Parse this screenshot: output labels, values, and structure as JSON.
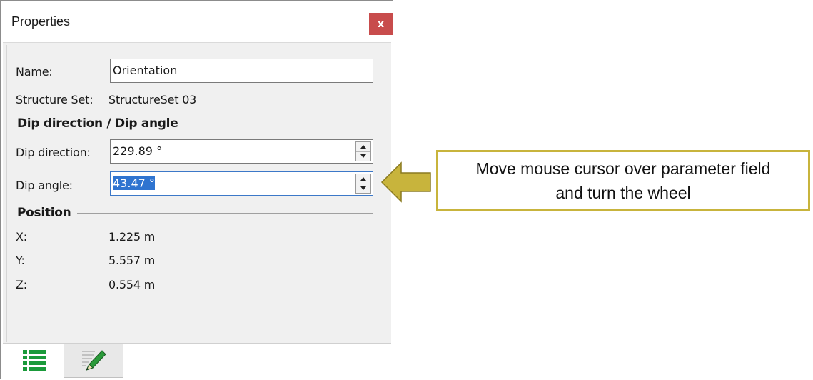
{
  "window": {
    "title": "Properties",
    "close_label": "x"
  },
  "fields": {
    "name_label": "Name:",
    "name_value": "Orientation",
    "structure_set_label": "Structure Set:",
    "structure_set_value": "StructureSet 03"
  },
  "dip_section": {
    "header": "Dip direction / Dip angle",
    "dip_direction_label": "Dip direction:",
    "dip_direction_value": "229.89 °",
    "dip_angle_label": "Dip angle:",
    "dip_angle_value": "43.47 °"
  },
  "position": {
    "header": "Position",
    "x_label": "X:",
    "x_value": "1.225 m",
    "y_label": "Y:",
    "y_value": "5.557 m",
    "z_label": "Z:",
    "z_value": "0.554 m"
  },
  "tabs": [
    {
      "icon": "list-icon",
      "active": true
    },
    {
      "icon": "edit-pencil-icon",
      "active": false
    }
  ],
  "callout": {
    "text_line1": "Move mouse cursor over parameter field",
    "text_line2": "and turn the wheel"
  },
  "colors": {
    "close_button": "#c84c4c",
    "selection": "#2f74d0",
    "callout_border": "#c8b43c",
    "arrow_fill": "#c8b43c",
    "tab_icon_green": "#1a9a3a"
  }
}
